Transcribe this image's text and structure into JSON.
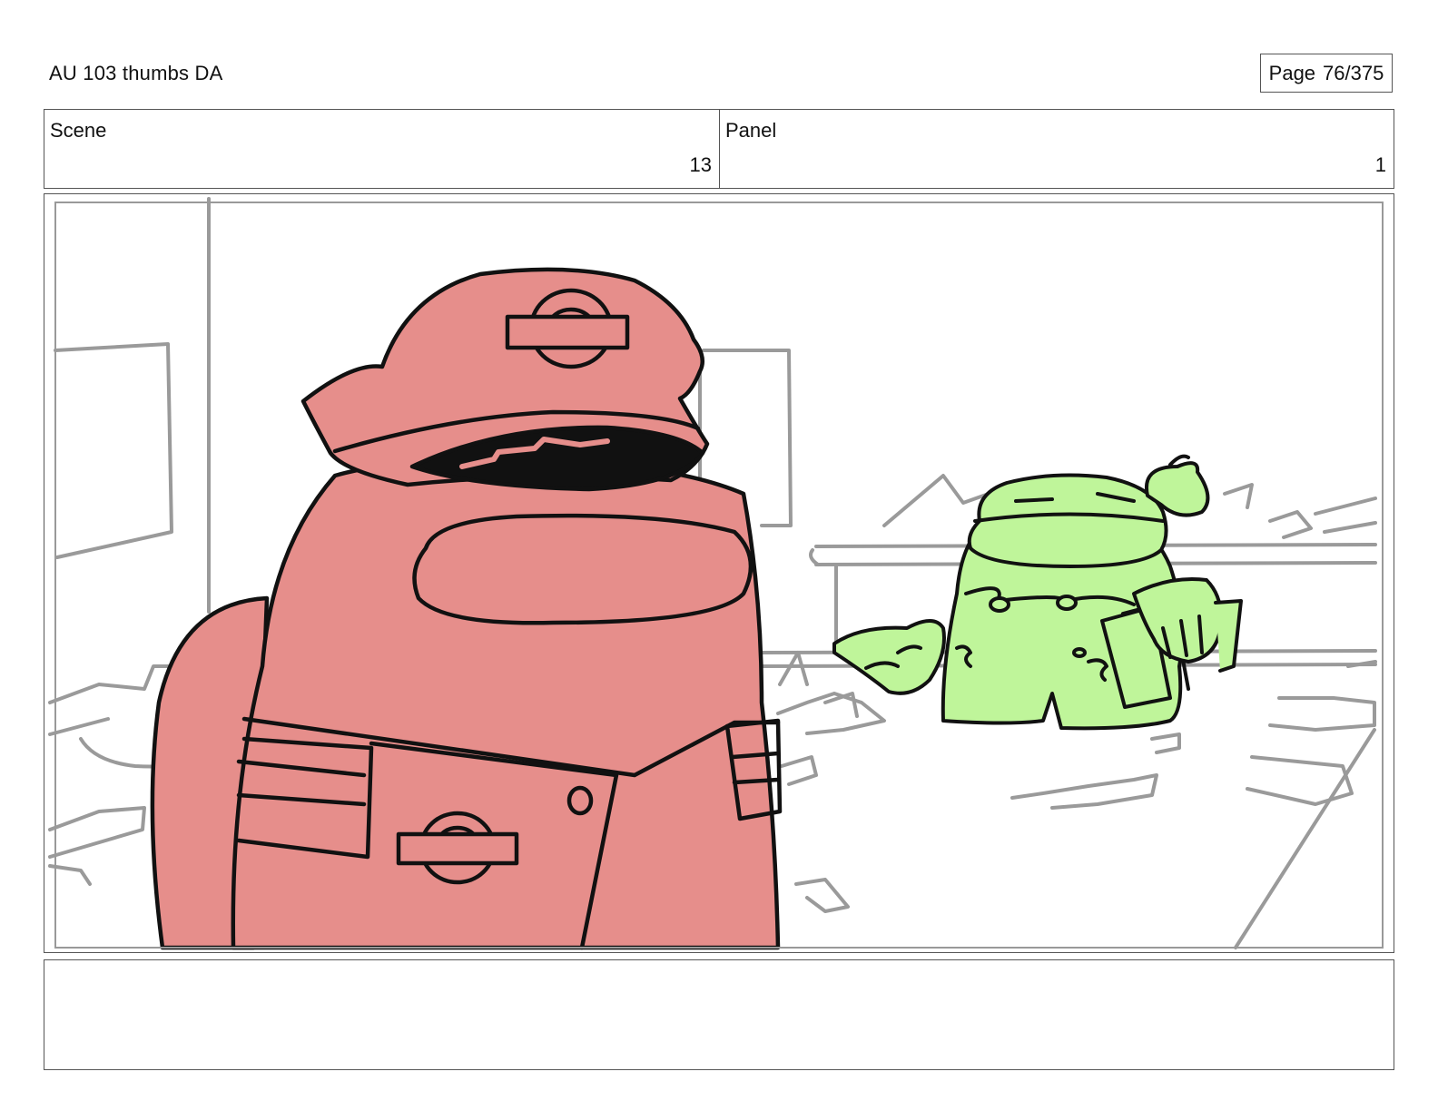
{
  "header": {
    "title": "AU 103 thumbs DA",
    "page_word": "Page",
    "page_number": "76/375"
  },
  "info": {
    "scene_label": "Scene",
    "scene_value": "13",
    "panel_label": "Panel",
    "panel_value": "1"
  },
  "frame": {
    "colors": {
      "red_character": "#e68e8b",
      "green_character": "#bff59a",
      "sketch_lines": "#9a9a9a",
      "ink": "#111111"
    }
  },
  "notes": {
    "text": ""
  }
}
